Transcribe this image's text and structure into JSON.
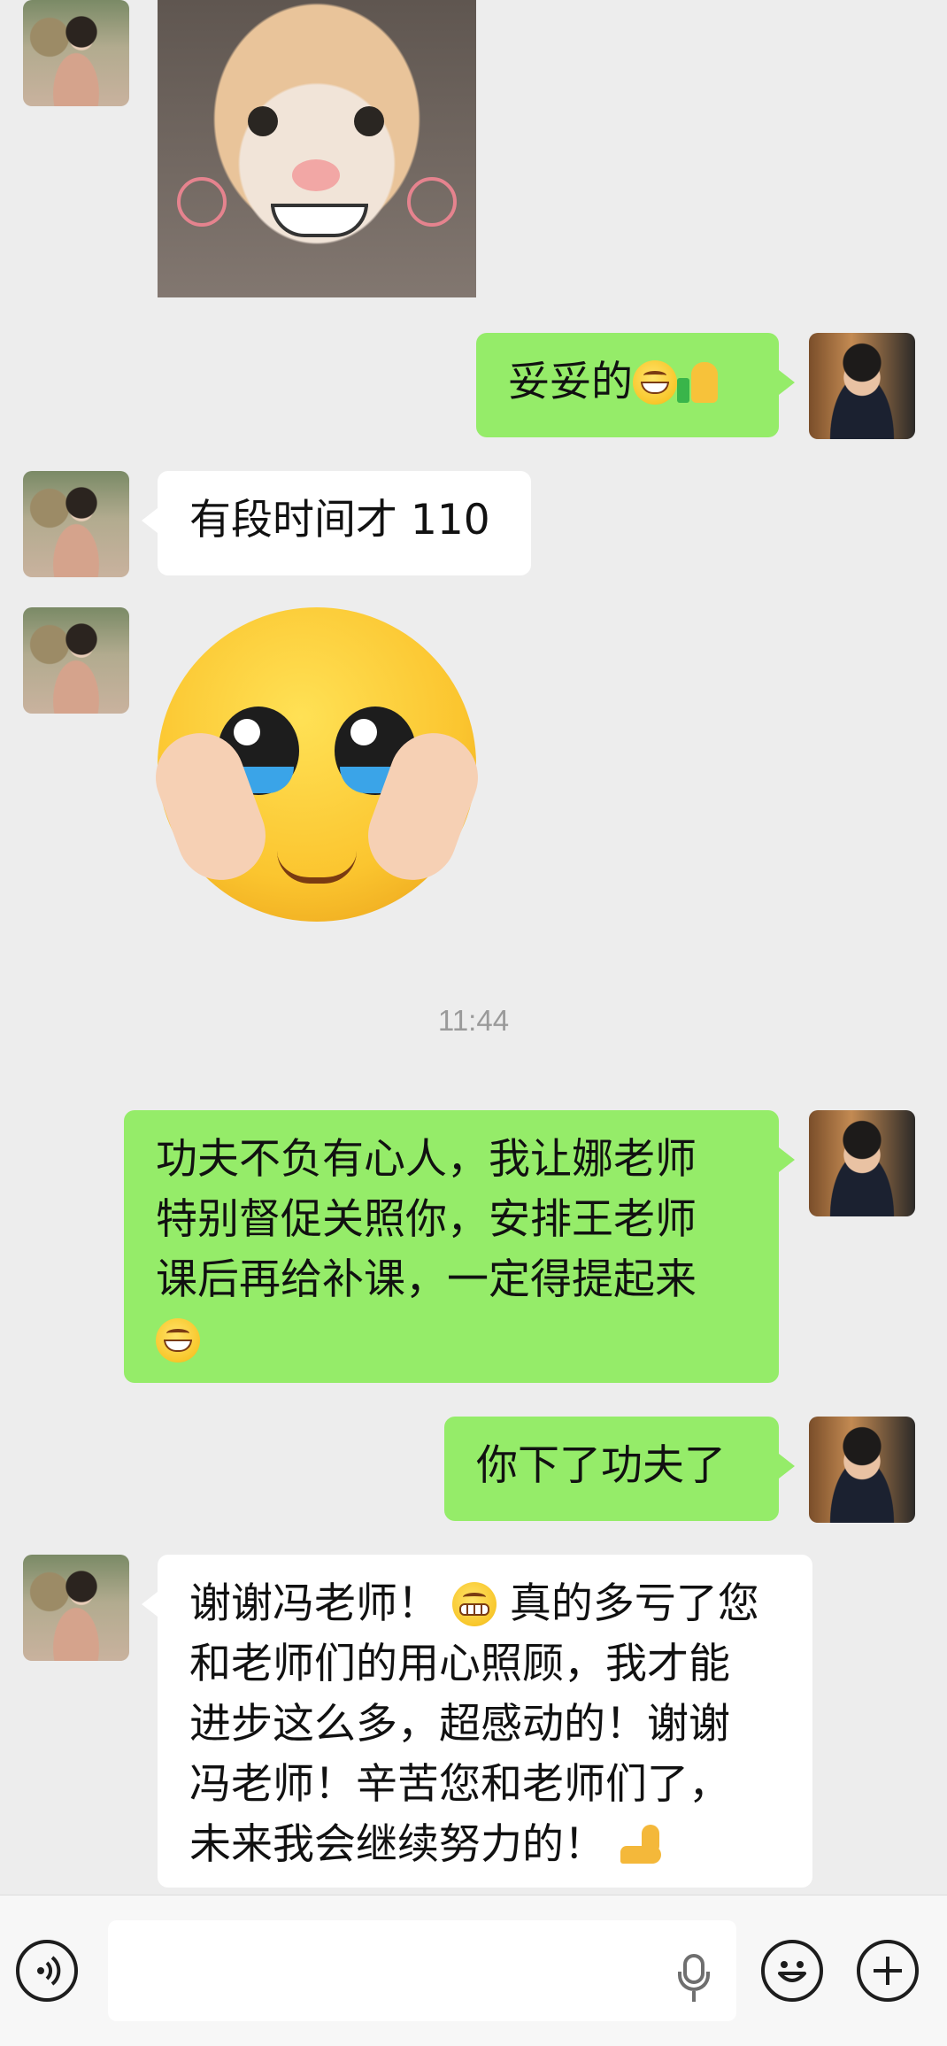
{
  "messages": {
    "m2": {
      "text": "妥妥的"
    },
    "m3": {
      "text": "有段时间才 110"
    },
    "time": "11:44",
    "m5": {
      "text": "功夫不负有心人，我让娜老师\n特别督促关照你，安排王老师\n课后再给补课，一定得提起来\n"
    },
    "m6": {
      "text": "你下了功夫了"
    },
    "m7": {
      "part1": "谢谢冯老师！",
      "part2": "真的多亏了您\n和老师们的用心照顾，我才能\n进步这么多，超感动的！谢谢\n冯老师！辛苦您和老师们了，\n未来我会继续努力的！"
    }
  },
  "icons": [
    "voice-icon",
    "microphone-icon",
    "emoji-icon",
    "plus-icon",
    "grin-emoji",
    "thumbs-up-emoji",
    "grimace-emoji",
    "flexed-biceps-emoji"
  ],
  "colors": {
    "sent_bubble": "#95ec69",
    "received_bubble": "#ffffff",
    "background": "#ededed"
  },
  "input": {
    "placeholder": ""
  }
}
